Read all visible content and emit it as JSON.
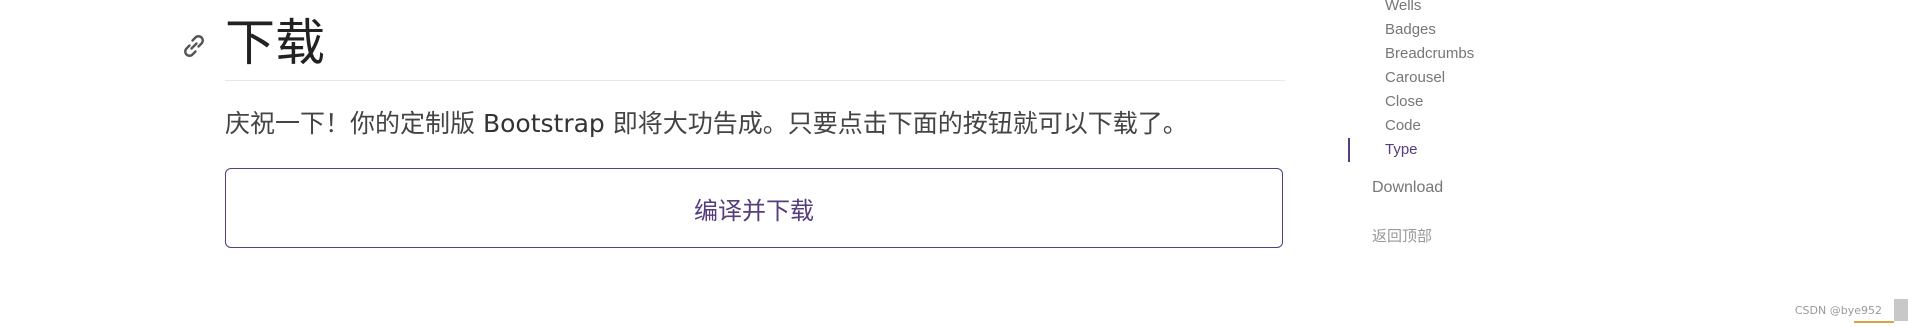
{
  "heading": {
    "title": "下载"
  },
  "lead": {
    "before": "庆祝一下！你的定制版 ",
    "brand": "Bootstrap",
    "after": " 即将大功告成。只要点击下面的按钮就可以下载了。"
  },
  "download_button": {
    "label": "编译并下载"
  },
  "sidebar": {
    "sub_items": [
      {
        "label": "Wells"
      },
      {
        "label": "Badges"
      },
      {
        "label": "Breadcrumbs"
      },
      {
        "label": "Carousel"
      },
      {
        "label": "Close"
      },
      {
        "label": "Code"
      },
      {
        "label": "Type",
        "active": true
      }
    ],
    "download_label": "Download",
    "back_to_top_label": "返回顶部"
  },
  "watermark": {
    "text": "CSDN @bye952"
  },
  "colors": {
    "accent": "#563d7c",
    "muted": "#767676",
    "text": "#333333"
  },
  "icons": {
    "anchor": "link-icon"
  }
}
